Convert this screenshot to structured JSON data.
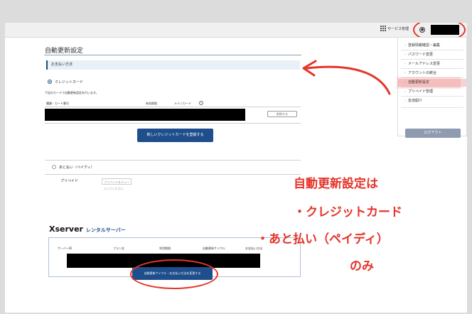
{
  "header": {
    "service_label": "サービス管理"
  },
  "page_title": "自動更新設定",
  "payment": {
    "section_title": "お支払い方法",
    "credit_label": "クレジットカード",
    "credit_note": "下記のカードで自動更新設定を行います。",
    "columns": [
      "種類・カード番号",
      "有効期限",
      "メインカード"
    ],
    "delete_label": "削除する",
    "register_label": "新しいクレジットカードを登録する",
    "atobarai_label": "あと払い（ペイディ）",
    "prepaid_label": "プリペイド",
    "prepaid_placeholder": "プリペイドをチャージしてください"
  },
  "dropdown": {
    "items": [
      {
        "label": "登録情報確認・編集",
        "highlight": false
      },
      {
        "label": "パスワード変更",
        "highlight": false
      },
      {
        "label": "メールアドレス変更",
        "highlight": false
      },
      {
        "label": "アカウントの統合",
        "highlight": false
      },
      {
        "label": "自動更新設定",
        "highlight": true
      },
      {
        "label": "プリペイド管理",
        "highlight": false
      },
      {
        "label": "友達紹介",
        "highlight": false
      }
    ],
    "logout_label": "ログアウト"
  },
  "xserver": {
    "brand": "Xserver",
    "subtitle": "レンタルサーバー",
    "columns": [
      "サーバーID",
      "プラン名",
      "利用期限",
      "自動更新サイクル",
      "お支払い方法"
    ],
    "change_button": "自動更新サイクル・お支払い方法を変更する"
  },
  "annotation": {
    "line1": "自動更新設定は",
    "line2": "・クレジットカード",
    "line3": "・あと払い（ペイディ）",
    "line4": "のみ",
    "color": "#e5342a"
  }
}
